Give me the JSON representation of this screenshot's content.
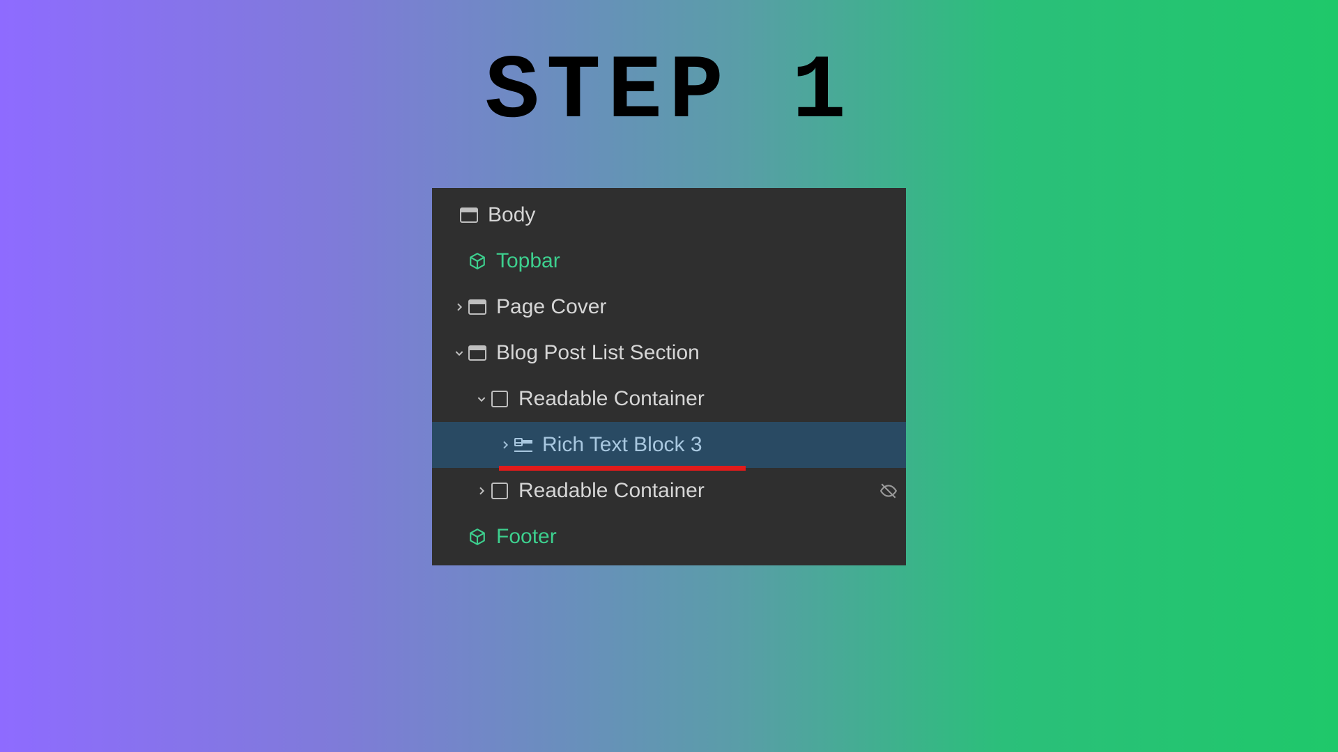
{
  "title": "STEP 1",
  "tree": {
    "body": {
      "label": "Body"
    },
    "topbar": {
      "label": "Topbar"
    },
    "pagecover": {
      "label": "Page Cover"
    },
    "blogsection": {
      "label": "Blog Post List Section"
    },
    "readable1": {
      "label": "Readable Container"
    },
    "richtext": {
      "label": "Rich Text Block 3"
    },
    "readable2": {
      "label": "Readable Container"
    },
    "footer": {
      "label": "Footer"
    }
  },
  "colors": {
    "accent_green": "#3dcf8e",
    "selected_bg": "#294a63",
    "highlight": "#e11b1b"
  }
}
